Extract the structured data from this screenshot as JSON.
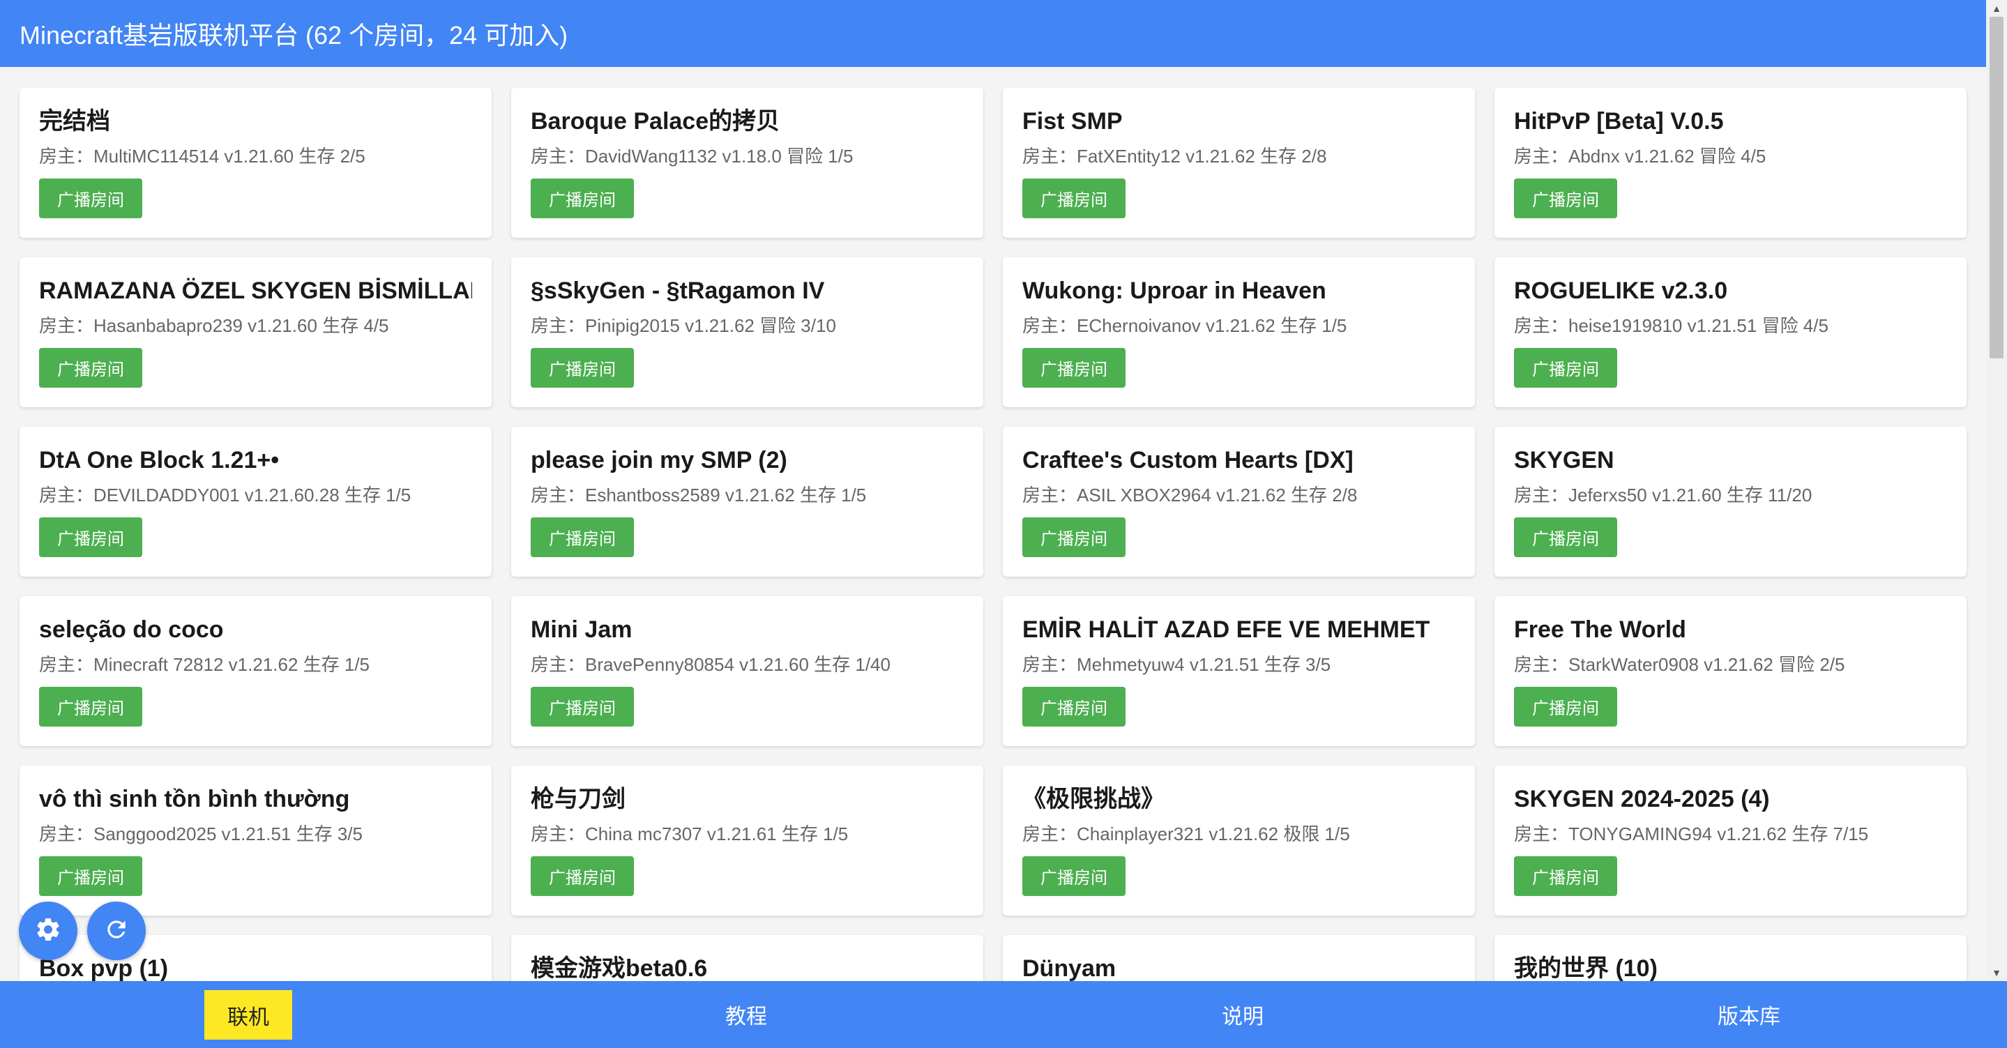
{
  "header": {
    "title": "Minecraft基岩版联机平台 (62 个房间，24 可加入)"
  },
  "rooms": [
    {
      "title": "完结档",
      "meta": "房主：MultiMC114514 v1.21.60 生存 2/5",
      "button": "广播房间"
    },
    {
      "title": "Baroque Palace的拷贝",
      "meta": "房主：DavidWang1132 v1.18.0 冒险 1/5",
      "button": "广播房间"
    },
    {
      "title": "Fist SMP",
      "meta": "房主：FatXEntity12 v1.21.62 生存 2/8",
      "button": "广播房间"
    },
    {
      "title": "HitPvP [Beta] V.0.5",
      "meta": "房主：Abdnx v1.21.62 冒险 4/5",
      "button": "广播房间"
    },
    {
      "title": "RAMAZANA ÖZEL SKYGEN BİSMİLLAH",
      "meta": "房主：Hasanbabapro239 v1.21.60 生存 4/5",
      "button": "广播房间"
    },
    {
      "title": "§sSkyGen - §tRagamon IV",
      "meta": "房主：Pinipig2015 v1.21.62 冒险 3/10",
      "button": "广播房间"
    },
    {
      "title": "Wukong: Uproar in Heaven",
      "meta": "房主：EChernoivanov v1.21.62 生存 1/5",
      "button": "广播房间"
    },
    {
      "title": "ROGUELIKE v2.3.0",
      "meta": "房主：heise1919810 v1.21.51 冒险 4/5",
      "button": "广播房间"
    },
    {
      "title": "DtA One Block 1.21+•",
      "meta": "房主：DEVILDADDY001 v1.21.60.28 生存 1/5",
      "button": "广播房间"
    },
    {
      "title": "please join my SMP (2)",
      "meta": "房主：Eshantboss2589 v1.21.62 生存 1/5",
      "button": "广播房间"
    },
    {
      "title": "Craftee's Custom Hearts [DX]",
      "meta": "房主：ASIL XBOX2964 v1.21.62 生存 2/8",
      "button": "广播房间"
    },
    {
      "title": "SKYGEN",
      "meta": "房主：Jeferxs50 v1.21.60 生存 11/20",
      "button": "广播房间"
    },
    {
      "title": "seleção do coco",
      "meta": "房主：Minecraft 72812 v1.21.62 生存 1/5",
      "button": "广播房间"
    },
    {
      "title": "Mini Jam",
      "meta": "房主：BravePenny80854 v1.21.60 生存 1/40",
      "button": "广播房间"
    },
    {
      "title": "EMİR HALİT AZAD EFE VE MEHMET",
      "meta": "房主：Mehmetyuw4 v1.21.51 生存 3/5",
      "button": "广播房间"
    },
    {
      "title": "Free The World",
      "meta": "房主：StarkWater0908 v1.21.62 冒险 2/5",
      "button": "广播房间"
    },
    {
      "title": "vô thì sinh tồn bình thường",
      "meta": "房主：Sanggood2025 v1.21.51 生存 3/5",
      "button": "广播房间"
    },
    {
      "title": "枪与刀剑",
      "meta": "房主：China mc7307 v1.21.61 生存 1/5",
      "button": "广播房间"
    },
    {
      "title": "《极限挑战》",
      "meta": "房主：Chainplayer321 v1.21.62 极限 1/5",
      "button": "广播房间"
    },
    {
      "title": "SKYGEN 2024-2025 (4)",
      "meta": "房主：TONYGAMING94 v1.21.62 生存 7/15",
      "button": "广播房间"
    },
    {
      "title": "Box pvp (1)",
      "meta": "",
      "button": ""
    },
    {
      "title": "模金游戏beta0.6",
      "meta": "",
      "button": ""
    },
    {
      "title": "Dünyam",
      "meta": "",
      "button": ""
    },
    {
      "title": "我的世界 (10)",
      "meta": "",
      "button": ""
    }
  ],
  "fabs": {
    "settings_icon": "gear-icon",
    "refresh_icon": "refresh-icon"
  },
  "nav": {
    "items": [
      "联机",
      "教程",
      "说明",
      "版本库"
    ],
    "active_index": 0
  },
  "colors": {
    "primary": "#4285f4",
    "button_green": "#4caf50",
    "active_tab": "#fde823"
  }
}
